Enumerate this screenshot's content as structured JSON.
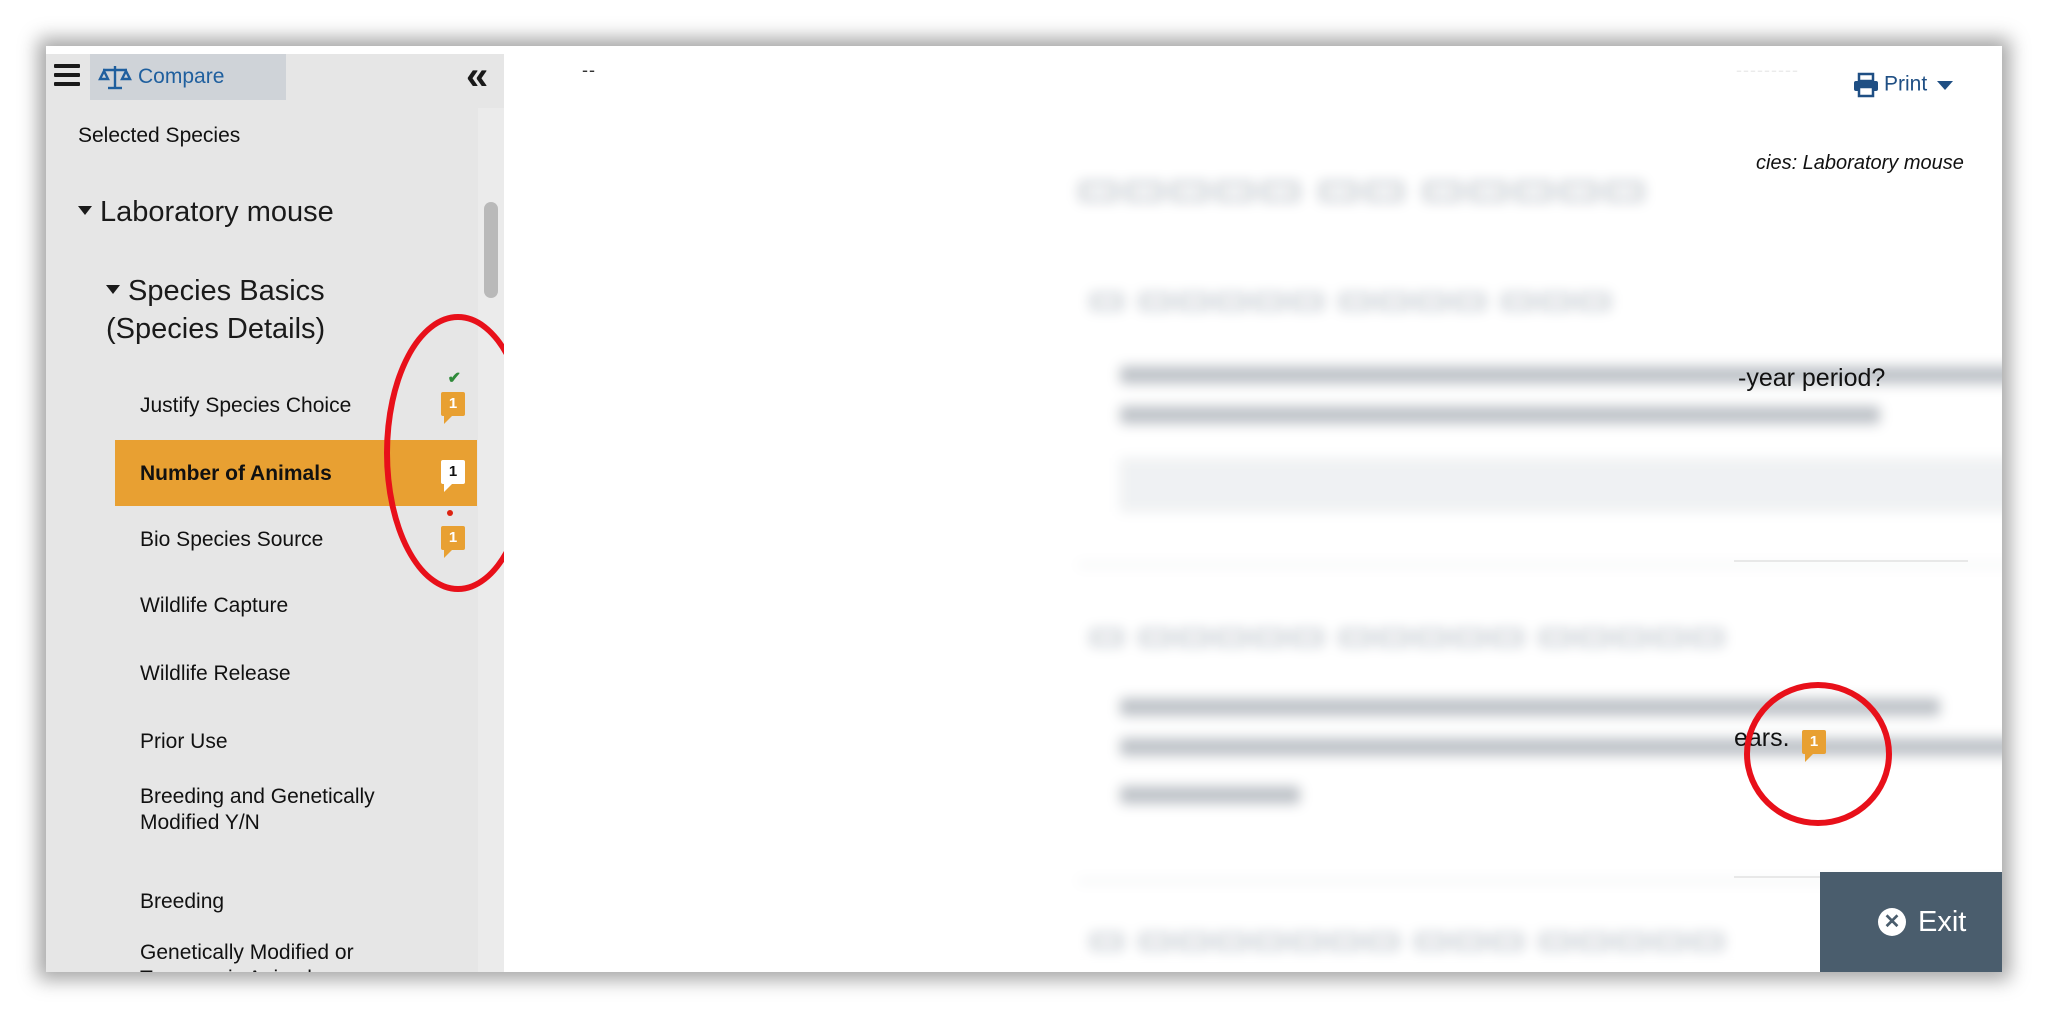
{
  "sidebar": {
    "compare_label": "Compare",
    "selected_species_label": "Selected Species",
    "species": "Laboratory mouse",
    "group": "Species Basics (Species Details)",
    "items": [
      {
        "label": "Justify Species Choice",
        "badge": "1"
      },
      {
        "label": "Number of Animals",
        "badge": "1"
      },
      {
        "label": "Bio Species Source",
        "badge": "1"
      },
      {
        "label": "Wildlife Capture"
      },
      {
        "label": "Wildlife Release"
      },
      {
        "label": "Prior Use"
      },
      {
        "label": "Breeding and Genetically Modified Y/N"
      },
      {
        "label": "Breeding"
      },
      {
        "label": "Genetically Modified or Transgenic Animals"
      }
    ]
  },
  "main": {
    "print_label": "Print",
    "species_line": "cies: Laboratory mouse",
    "question1_tail": "-year period?",
    "question2_tail": "ears.",
    "question2_badge": "1",
    "exit_label": "Exit",
    "dashes_left": "--",
    "dashes_right": "---------"
  },
  "colors": {
    "accent": "#e8a032",
    "exit_bg": "#4a5d6d",
    "link": "#1f5f9e",
    "highlight": "#e8101a"
  }
}
